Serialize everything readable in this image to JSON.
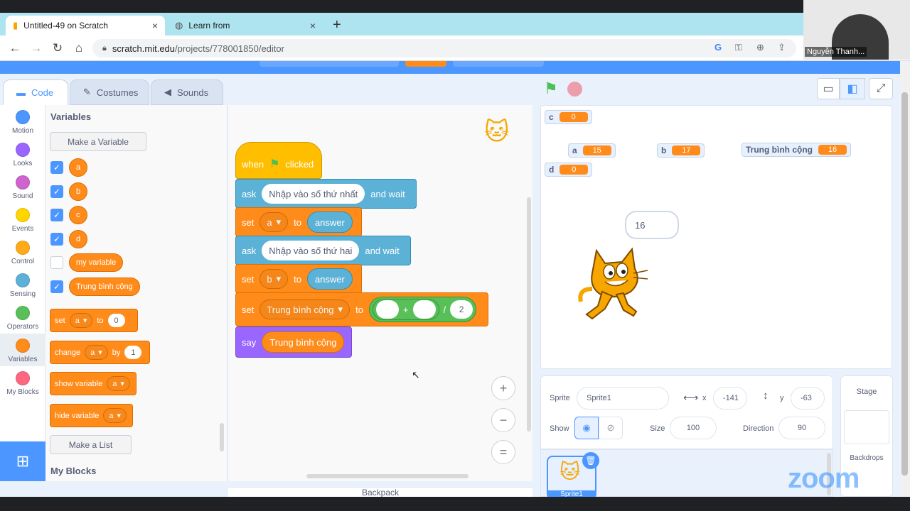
{
  "browser": {
    "tabs": [
      {
        "title": "Untitled-49 on Scratch",
        "close": "×"
      },
      {
        "title": "Learn from",
        "close": "×"
      }
    ],
    "new_tab": "+",
    "url_domain": "scratch.mit.edu",
    "url_path": "/projects/778001850/editor",
    "nav": {
      "back": "←",
      "forward": "→",
      "reload": "↻",
      "home": "⌂"
    }
  },
  "webcam": {
    "name": "Nguyễn Thanh..."
  },
  "editor_tabs": [
    {
      "label": "Code",
      "active": true
    },
    {
      "label": "Costumes",
      "active": false
    },
    {
      "label": "Sounds",
      "active": false
    }
  ],
  "categories": [
    {
      "label": "Motion",
      "color": "#4c97ff"
    },
    {
      "label": "Looks",
      "color": "#9966ff"
    },
    {
      "label": "Sound",
      "color": "#cf63cf"
    },
    {
      "label": "Events",
      "color": "#ffd500"
    },
    {
      "label": "Control",
      "color": "#ffab19"
    },
    {
      "label": "Sensing",
      "color": "#5cb1d6"
    },
    {
      "label": "Operators",
      "color": "#59c059"
    },
    {
      "label": "Variables",
      "color": "#ff8c1a",
      "selected": true
    },
    {
      "label": "My Blocks",
      "color": "#ff6680"
    }
  ],
  "palette": {
    "heading": "Variables",
    "make_variable": "Make a Variable",
    "variables": [
      {
        "name": "a",
        "checked": true
      },
      {
        "name": "b",
        "checked": true
      },
      {
        "name": "c",
        "checked": true
      },
      {
        "name": "d",
        "checked": true
      },
      {
        "name": "my variable",
        "checked": false
      },
      {
        "name": "Trung bình cộng",
        "checked": true
      }
    ],
    "set_block": {
      "op": "set",
      "var": "a",
      "to": "to",
      "value": "0"
    },
    "change_block": {
      "op": "change",
      "var": "a",
      "by": "by",
      "value": "1"
    },
    "show_block": {
      "op": "show variable",
      "var": "a"
    },
    "hide_block": {
      "op": "hide variable",
      "var": "a"
    },
    "make_list": "Make a List",
    "my_blocks_heading": "My Blocks"
  },
  "script": {
    "hat": {
      "when": "when",
      "clicked": "clicked"
    },
    "ask1": {
      "op": "ask",
      "text": "Nhập vào số thứ nhất",
      "wait": "and wait"
    },
    "set1": {
      "op": "set",
      "var": "a",
      "to": "to",
      "value": "answer"
    },
    "ask2": {
      "op": "ask",
      "text": "Nhập vào số thứ hai",
      "wait": "and wait"
    },
    "set2": {
      "op": "set",
      "var": "b",
      "to": "to",
      "value": "answer"
    },
    "set3": {
      "op": "set",
      "var": "Trung bình cộng",
      "to": "to",
      "plus": "+",
      "div": "/",
      "divisor": "2"
    },
    "say": {
      "op": "say",
      "value": "Trung bình cộng"
    }
  },
  "zoom_controls": {
    "in": "+",
    "out": "−",
    "reset": "="
  },
  "backpack": "Backpack",
  "stage": {
    "monitors": [
      {
        "name": "c",
        "value": "0"
      },
      {
        "name": "a",
        "value": "15"
      },
      {
        "name": "b",
        "value": "17"
      },
      {
        "name": "Trung bình cộng",
        "value": "16"
      },
      {
        "name": "d",
        "value": "0"
      }
    ],
    "bubble": "16"
  },
  "sprite_info": {
    "sprite_label": "Sprite",
    "sprite_name": "Sprite1",
    "x_label": "x",
    "x_value": "-141",
    "y_label": "y",
    "y_value": "-63",
    "show_label": "Show",
    "size_label": "Size",
    "size_value": "100",
    "direction_label": "Direction",
    "direction_value": "90"
  },
  "sprites": [
    {
      "name": "Sprite1"
    }
  ],
  "stage_panel": {
    "title": "Stage",
    "backdrops": "Backdrops"
  },
  "zoom_logo": "zoom",
  "colors": {
    "motion": "#4c97ff",
    "variables": "#ff8c1a",
    "events": "#ffbf00",
    "sensing": "#5cb1d6",
    "looks": "#9966ff",
    "operators": "#59c059",
    "accent": "#4c97ff"
  }
}
